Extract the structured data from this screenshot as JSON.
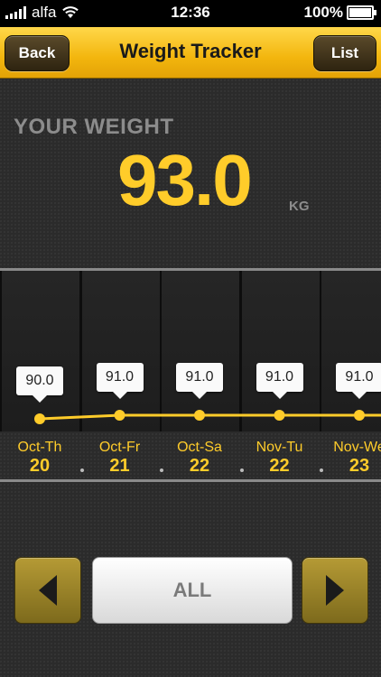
{
  "status_bar": {
    "carrier": "alfa",
    "time": "12:36",
    "battery": "100%"
  },
  "nav": {
    "back_label": "Back",
    "title": "Weight Tracker",
    "list_label": "List"
  },
  "weight": {
    "label": "YOUR WEIGHT",
    "value": "93.0",
    "unit": "KG"
  },
  "chart_data": {
    "type": "line",
    "color": "#ffcc2a",
    "points": [
      {
        "month_day": "Oct-Th",
        "date": "20",
        "value": 90.0,
        "label": "90.0"
      },
      {
        "month_day": "Oct-Fr",
        "date": "21",
        "value": 91.0,
        "label": "91.0"
      },
      {
        "month_day": "Oct-Sa",
        "date": "22",
        "value": 91.0,
        "label": "91.0"
      },
      {
        "month_day": "Nov-Tu",
        "date": "22",
        "value": 91.0,
        "label": "91.0"
      },
      {
        "month_day": "Nov-We",
        "date": "23",
        "value": 91.0,
        "label": "91.0"
      }
    ]
  },
  "controls": {
    "prev_icon": "triangle-left-icon",
    "all_label": "ALL",
    "next_icon": "triangle-right-icon"
  },
  "colors": {
    "accent": "#ffcc2a",
    "navbar": "#f3b60e",
    "background": "#2b2b2b"
  }
}
